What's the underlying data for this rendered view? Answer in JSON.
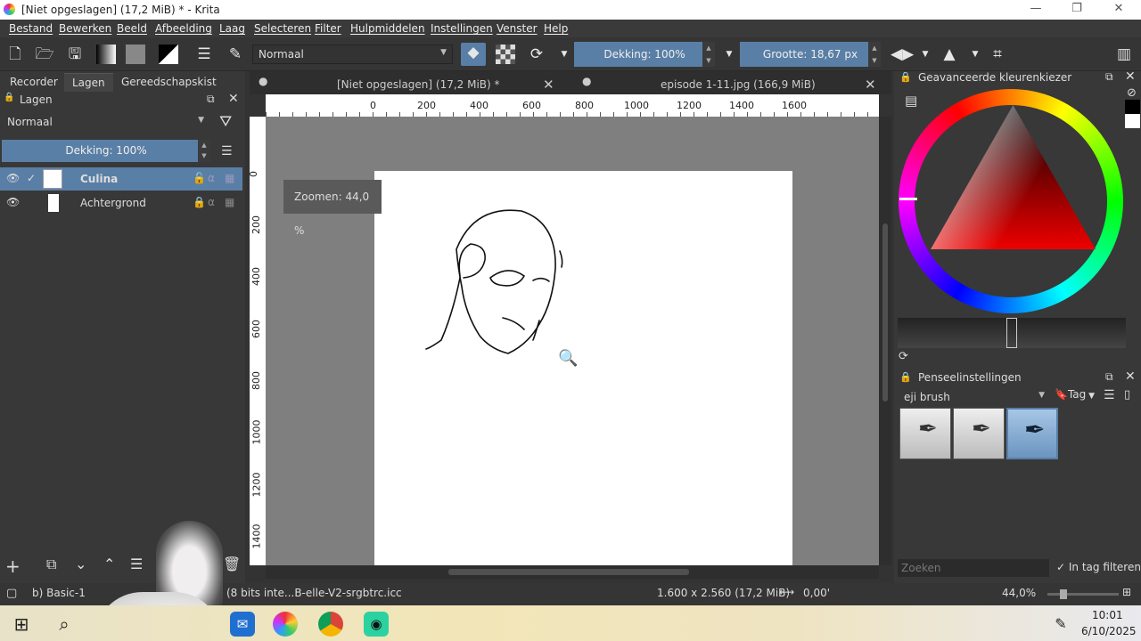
{
  "window": {
    "title": "[Niet opgeslagen]  (17,2 MiB) * - Krita"
  },
  "menu": [
    "Bestand",
    "Bewerken",
    "Beeld",
    "Afbeelding",
    "Laag",
    "Selecteren",
    "Filter",
    "Hulpmiddelen",
    "Instellingen",
    "Venster",
    "Help"
  ],
  "toolbar": {
    "blend_mode": "Normaal",
    "opacity_label": "Dekking: 100%",
    "size_label": "Grootte: 18,67 px"
  },
  "left_tabs": [
    "Recorder",
    "Lagen",
    "Gereedschapskist"
  ],
  "layers_docker": {
    "title": "Lagen",
    "blend_mode": "Normaal",
    "opacity_label": "Dekking:  100%",
    "layers": [
      {
        "name": "Culina",
        "selected": true
      },
      {
        "name": "Achtergrond",
        "selected": false
      }
    ]
  },
  "doc_tabs": [
    {
      "label": "[Niet opgeslagen]  (17,2 MiB) *"
    },
    {
      "label": "episode 1-11.jpg (166,9 MiB)"
    }
  ],
  "ruler_h": [
    "0",
    "200",
    "400",
    "600",
    "800",
    "1000",
    "1200",
    "1400",
    "1600"
  ],
  "ruler_v": [
    "0",
    "200",
    "400",
    "600",
    "800",
    "1000",
    "1200",
    "1400"
  ],
  "zoom_tooltip": "Zoomen: 44,0 %",
  "color_docker": {
    "title": "Geavanceerde kleurenkiezer"
  },
  "brush_docker": {
    "title": "Penseelinstellingen",
    "preset": "eji brush",
    "tag_label": "Tag",
    "search_placeholder": "Zoeken",
    "filter_label": "In tag filteren"
  },
  "status": {
    "brush": "b) Basic-1",
    "color_profile": "(8 bits inte...B-elle-V2-srgbtrc.icc",
    "dimensions": "1.600 x 2.560 (17,2 MiB)",
    "rotation": "0,00'",
    "zoom": "44,0%"
  },
  "taskbar": {
    "time": "10:01",
    "date": "6/10/2025"
  }
}
